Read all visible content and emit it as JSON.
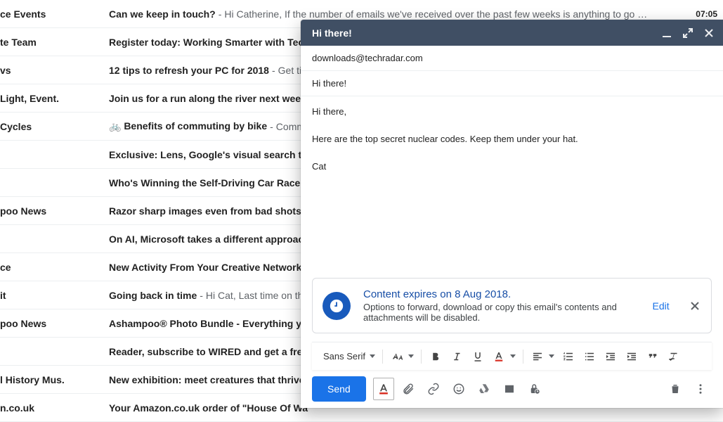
{
  "emails": [
    {
      "sender": "ce Events",
      "subject": "Can we keep in touch?",
      "snippet": "Hi Catherine, If the number of emails we've received over the past few weeks is anything to go …",
      "time": "07:05"
    },
    {
      "sender": "te Team",
      "subject": "Register today: Working Smarter with Tech",
      "snippet": ""
    },
    {
      "sender": "vs",
      "subject": "12 tips to refresh your PC for 2018",
      "snippet": "Get ti"
    },
    {
      "sender": "Light, Event.",
      "subject": "Join us for a run along the river next week",
      "snippet": ""
    },
    {
      "sender": "Cycles",
      "subject": "🚲 Benefits of commuting by bike",
      "snippet": "Comm"
    },
    {
      "sender": "",
      "subject": "Exclusive: Lens, Google's visual search too",
      "snippet": ""
    },
    {
      "sender": "",
      "subject": "Who's Winning the Self-Driving Car Race?",
      "snippet": ""
    },
    {
      "sender": "poo News",
      "subject": "Razor sharp images even from bad shots",
      "snippet": ""
    },
    {
      "sender": "",
      "subject": "On AI, Microsoft takes a different approac",
      "snippet": ""
    },
    {
      "sender": "ce",
      "subject": "New Activity From Your Creative Network",
      "snippet": ""
    },
    {
      "sender": "it",
      "subject": "Going back in time",
      "snippet": "Hi Cat, Last time on th"
    },
    {
      "sender": "poo News",
      "subject": "Ashampoo® Photo Bundle - Everything yo",
      "snippet": ""
    },
    {
      "sender": "",
      "subject": "Reader, subscribe to WIRED and get a free",
      "snippet": ""
    },
    {
      "sender": "l History Mus.",
      "subject": "New exhibition: meet creatures that thrive",
      "snippet": ""
    },
    {
      "sender": "n.co.uk",
      "subject": "Your Amazon.co.uk order of \"House Of Wa",
      "snippet": ""
    }
  ],
  "compose": {
    "title": "Hi there!",
    "to": "downloads@techradar.com",
    "subject": "Hi there!",
    "body": "Hi there,\n\nHere are the top secret nuclear codes. Keep them under your hat.\n\nCat",
    "banner": {
      "title": "Content expires on 8 Aug 2018.",
      "text": "Options to forward, download or copy this email's contents and attachments will be disabled.",
      "edit": "Edit"
    },
    "font": "Sans Serif",
    "send": "Send"
  }
}
